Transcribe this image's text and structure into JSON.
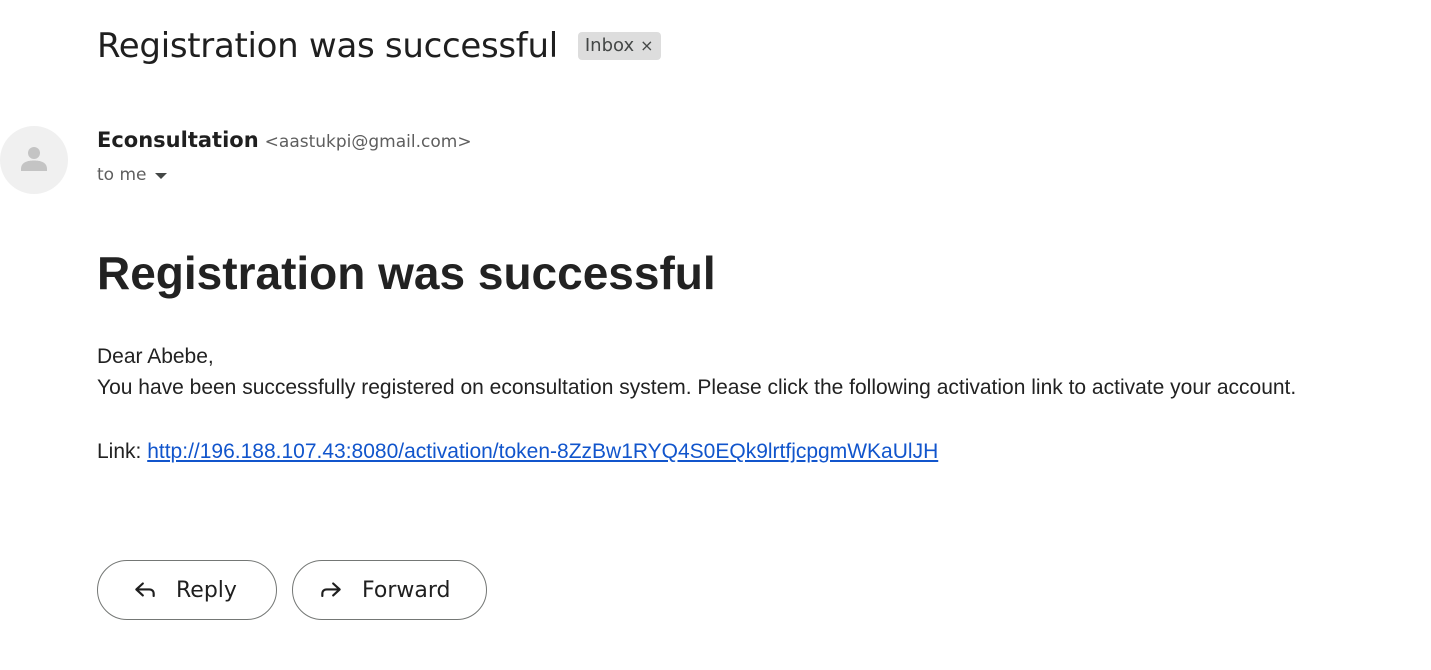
{
  "email": {
    "subject": "Registration was successful",
    "label_chip": {
      "text": "Inbox",
      "remove_glyph": "×"
    },
    "sender": {
      "name": "Econsultation",
      "email": "<aastukpi@gmail.com>",
      "avatar_icon": "person-icon"
    },
    "recipient": {
      "text": "to me",
      "dropdown_icon": "caret-down-icon"
    },
    "body": {
      "heading": "Registration was successful",
      "greeting": "Dear Abebe,",
      "message": "You have been successfully registered on econsultation system. Please click the following activation link to activate your account.",
      "link_label": "Link: ",
      "link_url": "http://196.188.107.43:8080/activation/token-8ZzBw1RYQ4S0EQk9lrtfjcpgmWKaUlJH"
    },
    "actions": {
      "reply_label": "Reply",
      "reply_icon": "reply-arrow-icon",
      "forward_label": "Forward",
      "forward_icon": "forward-arrow-icon"
    }
  },
  "colors": {
    "link": "#1155cc",
    "text": "#222222",
    "chip_background": "#dddddd",
    "button_border": "#747775"
  }
}
